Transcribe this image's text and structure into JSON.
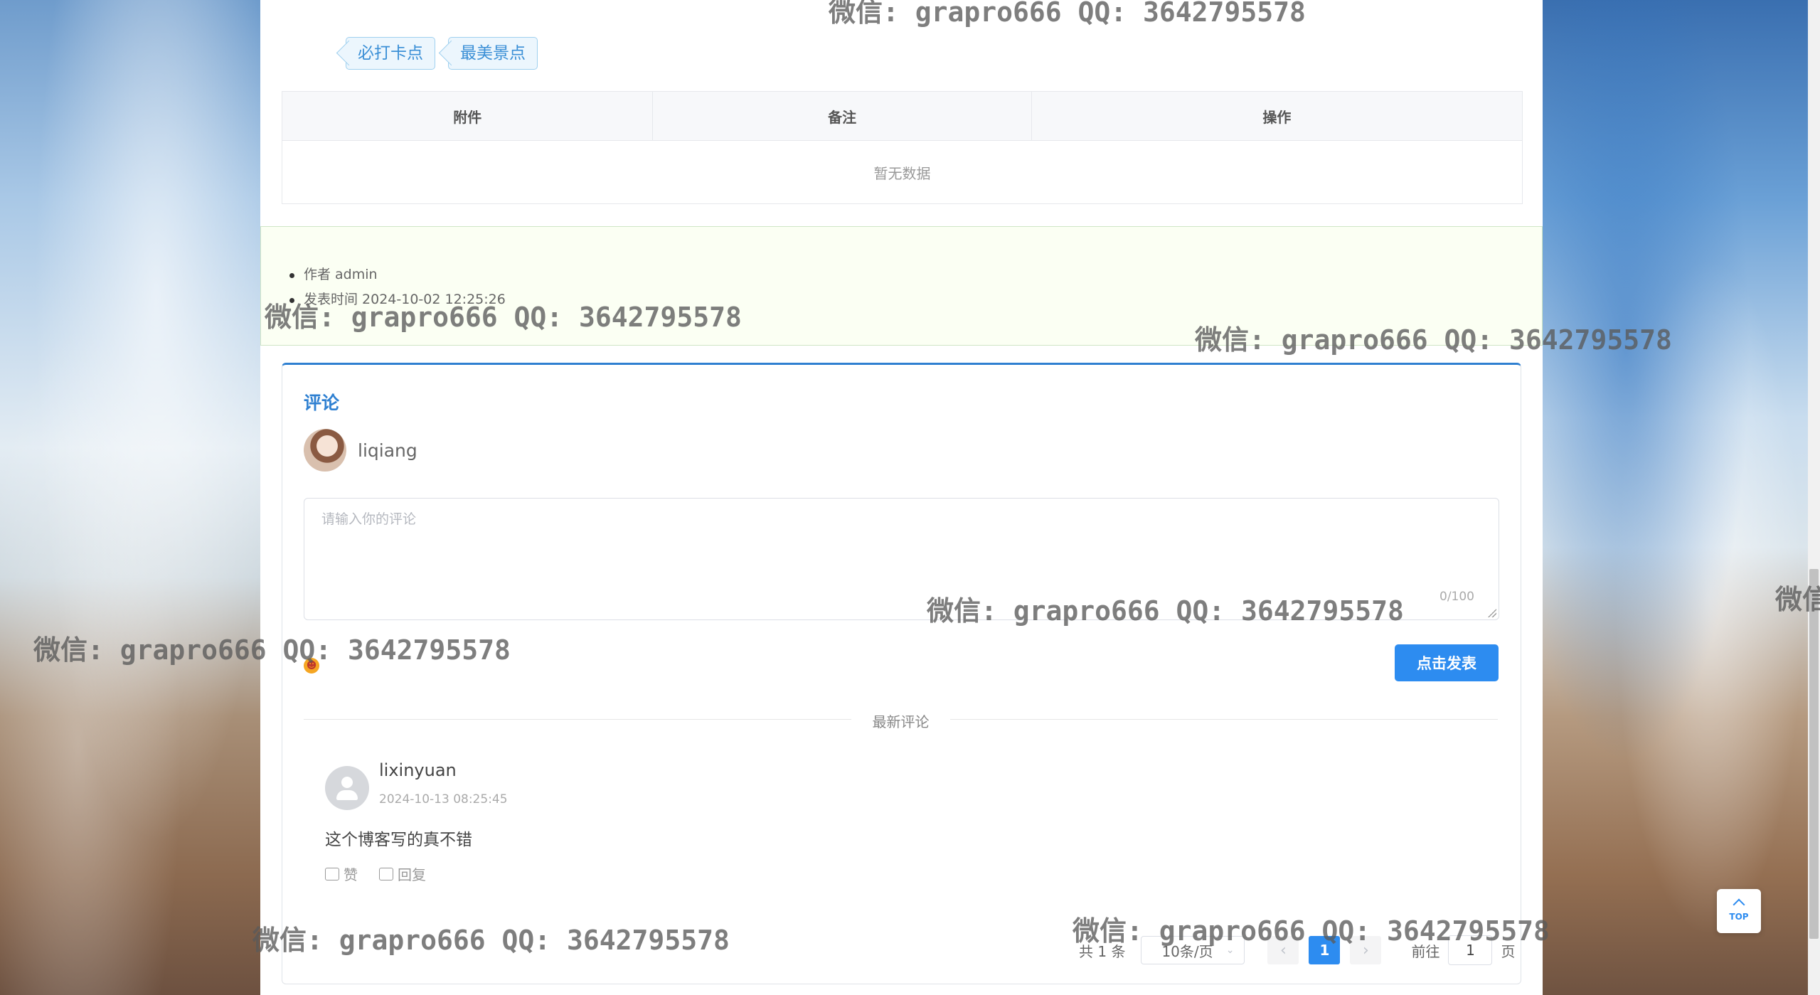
{
  "tags": [
    "必打卡点",
    "最美景点"
  ],
  "attachments_table": {
    "columns": [
      "附件",
      "备注",
      "操作"
    ],
    "empty_text": "暂无数据"
  },
  "post_meta": {
    "author": "作者 admin",
    "published": "发表时间 2024-10-02 12:25:26"
  },
  "comments_panel": {
    "title": "评论",
    "current_user": "liqiang",
    "input_placeholder": "请输入你的评论",
    "char_counter": "0/100",
    "submit_label": "点击发表",
    "divider_label": "最新评论"
  },
  "comments": [
    {
      "user": "lixinyuan",
      "time": "2024-10-13 08:25:45",
      "text": "这个博客写的真不错",
      "like_label": "赞",
      "reply_label": "回复"
    }
  ],
  "pagination": {
    "total": "共 1 条",
    "page_size": "10条/页",
    "current_page": "1",
    "goto_label": "前往",
    "goto_value": "1",
    "page_suffix": "页"
  },
  "back_to_top": "TOP",
  "watermark": "微信: grapro666 QQ: 3642795578",
  "watermark_partial": "微信",
  "colors": {
    "accent": "#2d8cf0",
    "tag_text": "#3a8fd6",
    "meta_bg": "#fbfff3"
  }
}
